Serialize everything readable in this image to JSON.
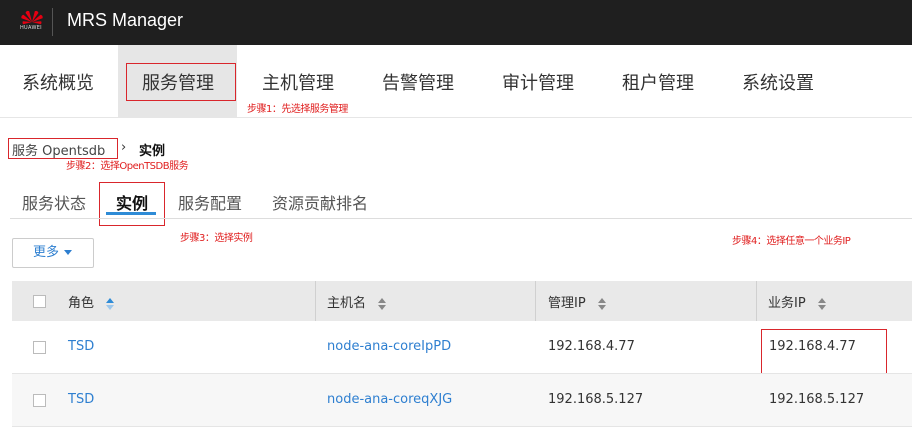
{
  "app": {
    "title": "MRS Manager",
    "logo_text": "HUAWEI"
  },
  "nav": {
    "items": [
      {
        "label": "系统概览"
      },
      {
        "label": "服务管理"
      },
      {
        "label": "主机管理"
      },
      {
        "label": "告警管理"
      },
      {
        "label": "审计管理"
      },
      {
        "label": "租户管理"
      },
      {
        "label": "系统设置"
      }
    ]
  },
  "annotations": {
    "step1": "步骤1：先选择服务管理",
    "step2": "步骤2：选择OpenTSDB服务",
    "step3": "步骤3：选择实例",
    "step4": "步骤4：选择任意一个业务IP"
  },
  "breadcrumb": {
    "service": "服务 Opentsdb",
    "separator": "›",
    "current": "实例"
  },
  "tabs": [
    {
      "label": "服务状态"
    },
    {
      "label": "实例"
    },
    {
      "label": "服务配置"
    },
    {
      "label": "资源贡献排名"
    }
  ],
  "toolbar": {
    "more_label": "更多"
  },
  "table": {
    "headers": {
      "role": "角色",
      "host": "主机名",
      "mgmt_ip": "管理IP",
      "biz_ip": "业务IP"
    },
    "rows": [
      {
        "role": "TSD",
        "host": "node-ana-coreIpPD",
        "mgmt_ip": "192.168.4.77",
        "biz_ip": "192.168.4.77"
      },
      {
        "role": "TSD",
        "host": "node-ana-coreqXJG",
        "mgmt_ip": "192.168.5.127",
        "biz_ip": "192.168.5.127"
      }
    ]
  },
  "colors": {
    "accent": "#2e7fd0",
    "annotation_red": "#e02020",
    "topbar": "#1f1f1f"
  }
}
